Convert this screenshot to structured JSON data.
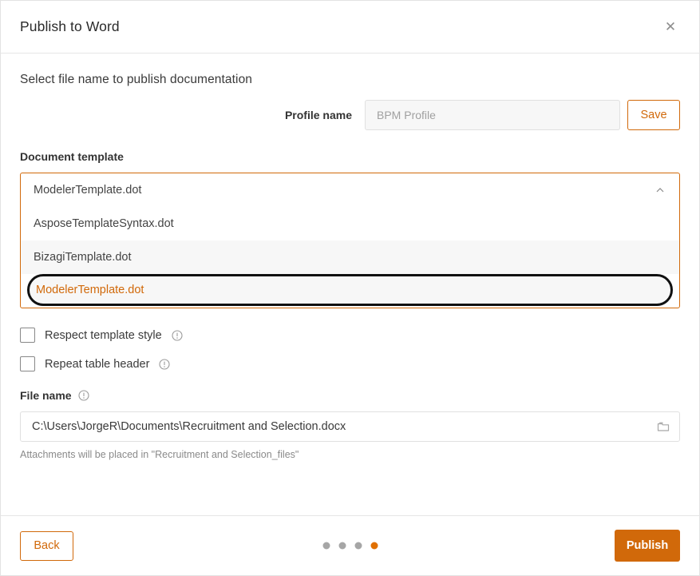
{
  "dialog": {
    "title": "Publish to Word",
    "close_icon": "close-icon"
  },
  "body": {
    "section_heading": "Select file name to publish documentation",
    "profile": {
      "label": "Profile name",
      "value": "",
      "placeholder": "BPM Profile",
      "save_label": "Save"
    },
    "document_template": {
      "label": "Document template",
      "selected": "ModelerTemplate.dot",
      "expanded": true,
      "options": [
        "AsposeTemplateSyntax.dot",
        "BizagiTemplate.dot",
        "ModelerTemplate.dot"
      ],
      "highlighted_option": "ModelerTemplate.dot"
    },
    "checkboxes": [
      {
        "label": "Respect template style",
        "checked": false
      },
      {
        "label": "Repeat table header",
        "checked": false
      }
    ],
    "file_name": {
      "label": "File name",
      "value": "C:\\Users\\JorgeR\\Documents\\Recruitment and Selection.docx",
      "help": "Attachments will be placed in \"Recruitment and Selection_files\""
    }
  },
  "footer": {
    "back_label": "Back",
    "publish_label": "Publish",
    "steps_total": 4,
    "step_active": 4
  },
  "colors": {
    "accent": "#d1690a",
    "dot_inactive": "#a6a6a6",
    "dot_active": "#e07000",
    "text": "#3a3a3a"
  }
}
